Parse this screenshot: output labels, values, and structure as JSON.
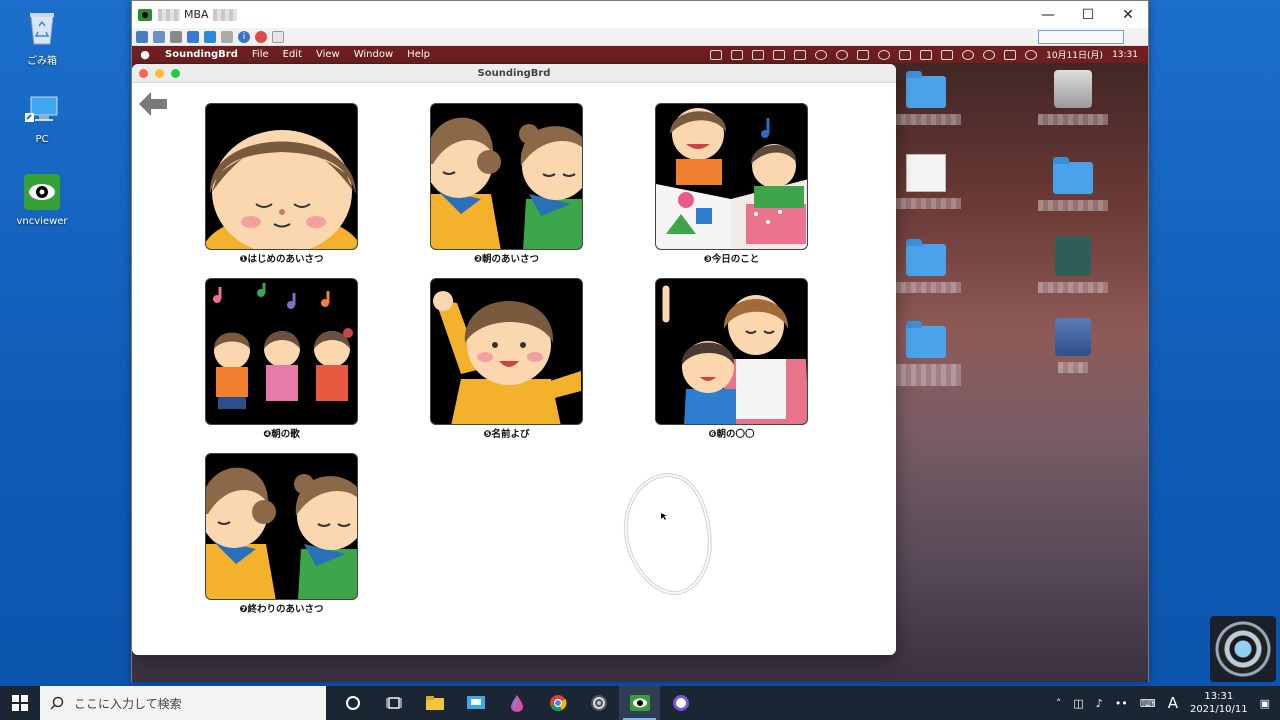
{
  "desktop": {
    "icons": [
      {
        "label": "ごみ箱",
        "icon": "recycle-bin-icon"
      },
      {
        "label": "PC",
        "icon": "pc-icon"
      },
      {
        "label": "vncviewer",
        "icon": "vncviewer-icon"
      }
    ]
  },
  "vnc": {
    "title_visible": "MBA"
  },
  "mac": {
    "menu": {
      "app_name": "SoundingBrd",
      "items": [
        "File",
        "Edit",
        "View",
        "Window",
        "Help"
      ]
    },
    "status": {
      "date": "10月11日(月)",
      "time": "13:31"
    }
  },
  "soundingbrd": {
    "title": "SoundingBrd",
    "cards": [
      {
        "label": "❶はじめのあいさつ"
      },
      {
        "label": "❷朝のあいさつ"
      },
      {
        "label": "❸今日のこと"
      },
      {
        "label": "❹朝の歌"
      },
      {
        "label": "❺名前よび"
      },
      {
        "label": "❻朝の〇〇"
      },
      {
        "label": "❼終わりのあいさつ"
      }
    ]
  },
  "taskbar": {
    "search_placeholder": "ここに入力して検索",
    "ime": "A",
    "clock_time": "13:31",
    "clock_date": "2021/10/11"
  }
}
